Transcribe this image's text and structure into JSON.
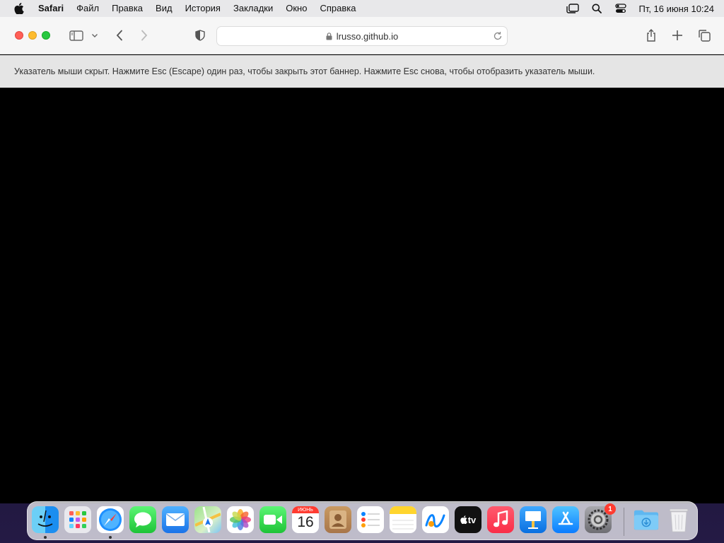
{
  "menubar": {
    "app_name": "Safari",
    "menus": [
      "Файл",
      "Правка",
      "Вид",
      "История",
      "Закладки",
      "Окно",
      "Справка"
    ],
    "clock": "Пт, 16 июня  10:24"
  },
  "browser": {
    "url": "lrusso.github.io",
    "banner_text": "Указатель мыши скрыт. Нажмите Esc (Escape) один раз, чтобы закрыть этот баннер. Нажмите Esc снова, чтобы отобразить указатель мыши."
  },
  "dock": {
    "apps": [
      {
        "name": "finder-icon",
        "running": true
      },
      {
        "name": "launchpad-icon",
        "running": false
      },
      {
        "name": "safari-icon",
        "running": true
      },
      {
        "name": "messages-icon",
        "running": false
      },
      {
        "name": "mail-icon",
        "running": false
      },
      {
        "name": "maps-icon",
        "running": false
      },
      {
        "name": "photos-icon",
        "running": false
      },
      {
        "name": "facetime-icon",
        "running": false
      },
      {
        "name": "calendar-icon",
        "running": false
      },
      {
        "name": "contacts-icon",
        "running": false
      },
      {
        "name": "reminders-icon",
        "running": false
      },
      {
        "name": "notes-icon",
        "running": false
      },
      {
        "name": "freeform-icon",
        "running": false
      },
      {
        "name": "apple-tv-icon",
        "running": false
      },
      {
        "name": "music-icon",
        "running": false
      },
      {
        "name": "keynote-icon",
        "running": false
      },
      {
        "name": "app-store-icon",
        "running": false
      },
      {
        "name": "system-settings-icon",
        "running": false
      },
      {
        "name": "downloads-folder-icon",
        "running": false
      },
      {
        "name": "trash-icon",
        "running": false
      }
    ],
    "calendar_month": "ИЮНЬ",
    "calendar_day": "16",
    "tv_label": "tv",
    "settings_badge": "1"
  }
}
